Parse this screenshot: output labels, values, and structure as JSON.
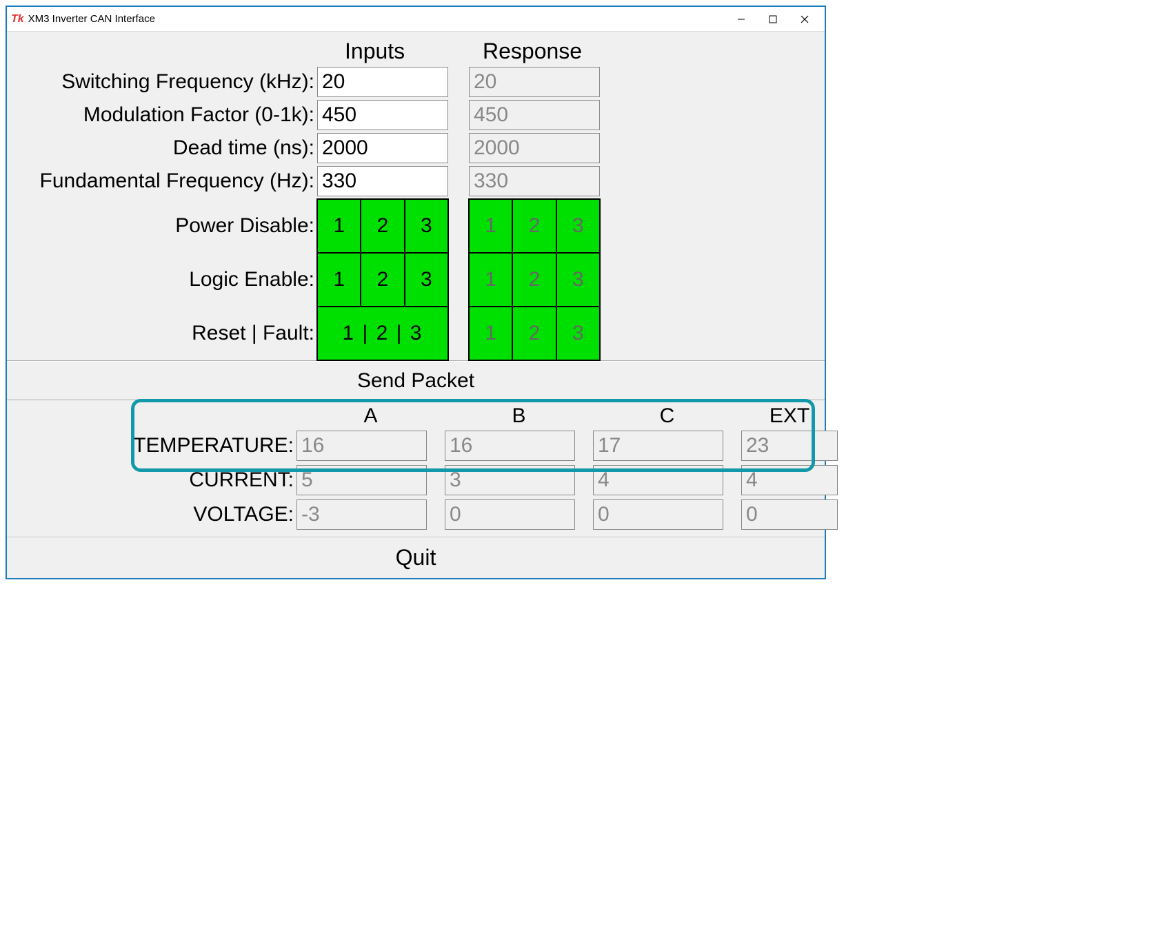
{
  "title": "XM3 Inverter CAN Interface",
  "headers": {
    "inputs": "Inputs",
    "response": "Response"
  },
  "params": {
    "switching_freq": {
      "label": "Switching Frequency (kHz):",
      "input": "20",
      "response": "20"
    },
    "modulation": {
      "label": "Modulation Factor (0-1k):",
      "input": "450",
      "response": "450"
    },
    "dead_time": {
      "label": "Dead time (ns):",
      "input": "2000",
      "response": "2000"
    },
    "fundamental": {
      "label": "Fundamental Frequency (Hz):",
      "input": "330",
      "response": "330"
    }
  },
  "green_rows": {
    "power_disable": {
      "label": "Power Disable:",
      "input_cells": [
        "1",
        "2",
        "3"
      ],
      "response_cells": [
        "1",
        "2",
        "3"
      ]
    },
    "logic_enable": {
      "label": "Logic Enable:",
      "input_cells": [
        "1",
        "2",
        "3"
      ],
      "response_cells": [
        "1",
        "2",
        "3"
      ]
    },
    "reset_fault": {
      "label": "Reset | Fault:",
      "input_combined": "1 | 2 | 3",
      "response_cells": [
        "1",
        "2",
        "3"
      ]
    }
  },
  "send_label": "Send Packet",
  "readings": {
    "cols": {
      "a": "A",
      "b": "B",
      "c": "C",
      "ext": "EXT"
    },
    "temperature": {
      "label": "TEMPERATURE:",
      "a": "16",
      "b": "16",
      "c": "17",
      "ext": "23"
    },
    "current": {
      "label": "CURRENT:",
      "a": "5",
      "b": "3",
      "c": "4",
      "ext": "4"
    },
    "voltage": {
      "label": "VOLTAGE:",
      "a": "-3",
      "b": "0",
      "c": "0",
      "ext": "0"
    }
  },
  "quit_label": "Quit"
}
